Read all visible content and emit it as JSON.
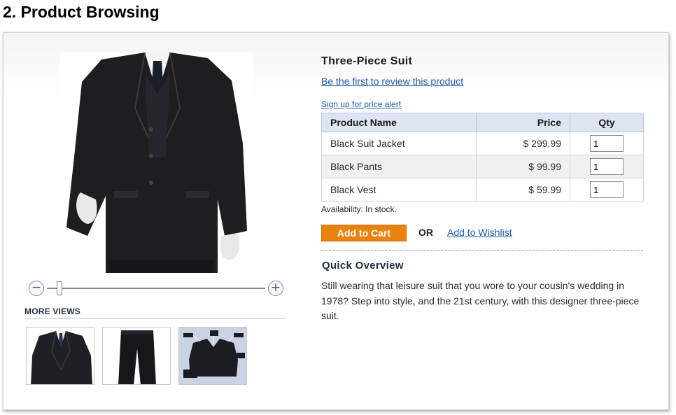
{
  "slide_title": "2. Product Browsing",
  "product": {
    "name": "Three-Piece Suit",
    "review_link": "Be the first to review this product",
    "price_alert_link": "Sign up for price alert",
    "availability": "Availability: In stock."
  },
  "table": {
    "headers": {
      "name": "Product Name",
      "price": "Price",
      "qty": "Qty"
    },
    "rows": [
      {
        "name": "Black Suit Jacket",
        "price": "$ 299.99",
        "qty": "1"
      },
      {
        "name": "Black Pants",
        "price": "$ 99.99",
        "qty": "1"
      },
      {
        "name": "Black Vest",
        "price": "$ 59.99",
        "qty": "1"
      }
    ]
  },
  "actions": {
    "add_to_cart": "Add to Cart",
    "or": "OR",
    "wishlist": "Add to Wishlist"
  },
  "overview": {
    "title": "Quick Overview",
    "text": "Still wearing that leisure suit that you wore to your cousin's wedding in 1978? Step into style, and the 21st century, with this designer three-piece suit."
  },
  "gallery": {
    "more_views_label": "MORE VIEWS",
    "zoom_out_icon": "minus-circle-icon",
    "zoom_in_icon": "plus-circle-icon",
    "zoom_level": 0.05,
    "thumbnails": [
      "suit-jacket-thumbnail",
      "pants-thumbnail",
      "accessories-thumbnail"
    ]
  },
  "colors": {
    "link": "#1f5eaa",
    "button": "#e9820f",
    "table_header": "#dde6f0"
  }
}
